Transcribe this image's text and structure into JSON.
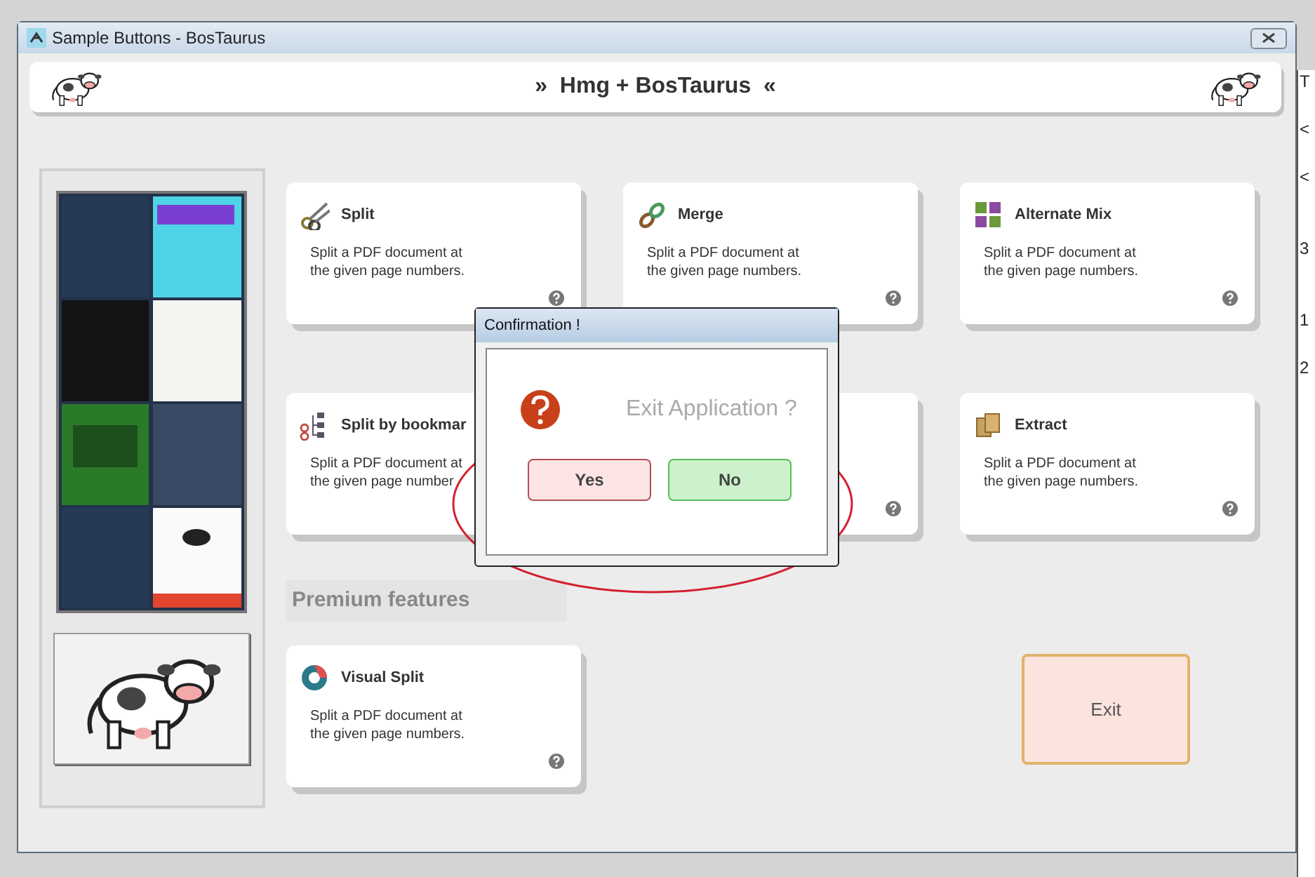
{
  "window": {
    "title": "Sample Buttons - BosTaurus"
  },
  "header": {
    "title": "»  Hmg + BosTaurus  «"
  },
  "tools": [
    {
      "title": "Split",
      "description": [
        "Split a PDF document at",
        "the given page numbers."
      ]
    },
    {
      "title": "Merge",
      "description": [
        "Split a PDF document at",
        "the given page numbers."
      ]
    },
    {
      "title": "Alternate Mix",
      "description": [
        "Split a PDF document at",
        "the given page numbers."
      ]
    },
    {
      "title": "Split by bookmar",
      "description": [
        "Split a PDF document at",
        "the given page number"
      ]
    },
    {
      "title": "Extract",
      "description": [
        "Split a PDF document at",
        "the given page numbers."
      ]
    }
  ],
  "premium": {
    "heading": "Premium features",
    "tools": [
      {
        "title": "Visual Split",
        "description": [
          "Split a PDF document at",
          "the given page numbers."
        ]
      }
    ]
  },
  "exit_button": {
    "label": "Exit"
  },
  "dialog": {
    "title": "Confirmation !",
    "message": "Exit Application ?",
    "buttons": [
      {
        "label": "Yes",
        "kind": "danger"
      },
      {
        "label": "No",
        "kind": "success"
      }
    ]
  },
  "background_window": {
    "lines": [
      "T",
      "<",
      "<",
      "3",
      "1",
      "2"
    ]
  }
}
